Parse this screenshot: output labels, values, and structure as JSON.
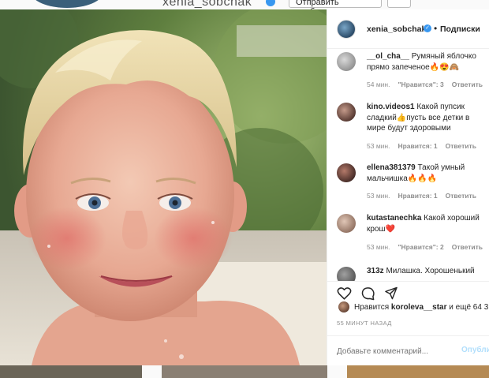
{
  "background": {
    "username": "xenia_sobchak",
    "message_button": "Отправить сообщение"
  },
  "post": {
    "author": "xenia_sobchak",
    "follow_label": "Подписки",
    "dot": "•",
    "comments": [
      {
        "user": "__ol_cha__",
        "text": "Румяный яблочко прямо запеченое🔥😍🙈",
        "time": "54 мин.",
        "likes": "\"Нравится\": 3",
        "reply": "Ответить"
      },
      {
        "user": "kino.videos1",
        "text": "Какой пупсик сладкий👍пусть все детки в мире будут здоровыми",
        "time": "53 мин.",
        "likes": "Нравится: 1",
        "reply": "Ответить"
      },
      {
        "user": "ellena381379",
        "text": "Такой умный мальчишка🔥🔥🔥",
        "time": "53 мин.",
        "likes": "Нравится: 1",
        "reply": "Ответить"
      },
      {
        "user": "kutastanechka",
        "text": "Какой хороший крош❤️",
        "time": "53 мин.",
        "likes": "\"Нравится\": 2",
        "reply": "Ответить"
      },
      {
        "user": "313z",
        "text": "Милашка. Хорошенький",
        "time": "",
        "likes": "",
        "reply": ""
      }
    ],
    "likes_prefix": "Нравится ",
    "likes_user": "koroleva__star",
    "likes_suffix": " и ещё 64 3",
    "time_ago": "55 МИНУТ НАЗАД",
    "add_comment_placeholder": "Добавьте комментарий...",
    "post_button": "Опубли"
  },
  "icons": {
    "like": "heart-icon",
    "comment": "comment-icon",
    "share": "send-icon",
    "verified": "verified-badge-icon"
  },
  "colors": {
    "verified": "#3897f0",
    "post_button": "#b2dffc",
    "meta_text": "#8e8e8e"
  }
}
